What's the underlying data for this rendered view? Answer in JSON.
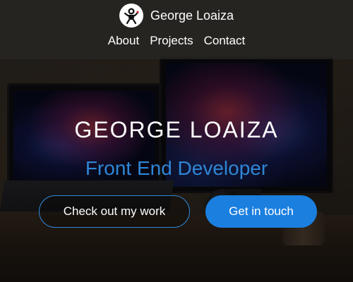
{
  "header": {
    "brand_name": "George Loaiza",
    "logo_icon": "astronaut-icon",
    "nav": [
      {
        "label": "About"
      },
      {
        "label": "Projects"
      },
      {
        "label": "Contact"
      }
    ]
  },
  "hero": {
    "name": "GEORGE LOAIZA",
    "role": "Front End Developer",
    "primary_cta": "Check out my work",
    "secondary_cta": "Get in touch"
  },
  "colors": {
    "accent": "#2f86d6",
    "button_fill": "#1b7fe0",
    "header_bg": "#282624"
  }
}
